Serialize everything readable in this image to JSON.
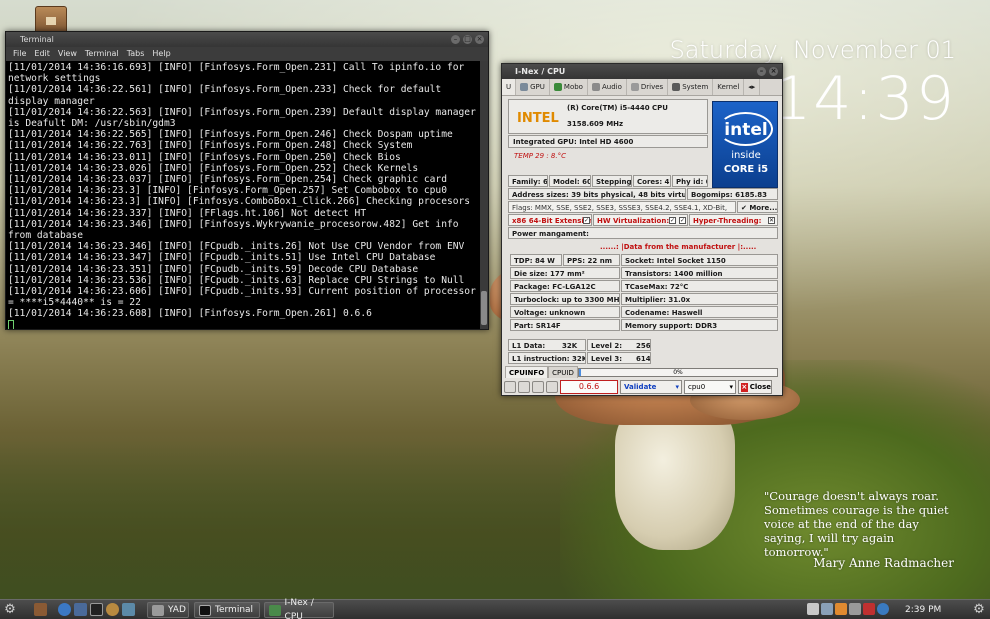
{
  "desktop": {
    "date": "Saturday, November 01",
    "time": "14:39",
    "quote": "\"Courage doesn't always roar. Sometimes courage is the quiet voice at the end of the day saying, I will try again tomorrow.\"",
    "quote_author": "Mary Anne Radmacher"
  },
  "terminal": {
    "title": "Terminal",
    "menu": [
      "File",
      "Edit",
      "View",
      "Terminal",
      "Tabs",
      "Help"
    ],
    "lines": [
      "[11/01/2014 14:36:16.693] [INFO] [Finfosys.Form_Open.231] Call To ipinfo.io for network settings",
      "[11/01/2014 14:36:22.561] [INFO] [Finfosys.Form_Open.233] Check for default display manager",
      "[11/01/2014 14:36:22.563] [INFO] [Finfosys.Form_Open.239] Default display manager is Deafult DM: /usr/sbin/gdm3",
      "[11/01/2014 14:36:22.565] [INFO] [Finfosys.Form_Open.246] Check Dospam uptime",
      "[11/01/2014 14:36:22.763] [INFO] [Finfosys.Form_Open.248] Check System",
      "[11/01/2014 14:36:23.011] [INFO] [Finfosys.Form_Open.250] Check Bios",
      "[11/01/2014 14:36:23.026] [INFO] [Finfosys.Form_Open.252] Check Kernels",
      "[11/01/2014 14:36:23.037] [INFO] [Finfosys.Form_Open.254] Check graphic card",
      "[11/01/2014 14:36:23.3] [INFO] [Finfosys.Form_Open.257] Set Combobox to cpu0",
      "[11/01/2014 14:36:23.3] [INFO] [Finfosys.ComboBox1_Click.266] Checking procesors",
      "[11/01/2014 14:36:23.337] [INFO] [FFlags.ht.106] Not detect HT",
      "[11/01/2014 14:36:23.346] [INFO] [Finfosys.Wykrywanie_procesorow.482] Get info from database",
      "[11/01/2014 14:36:23.346] [INFO] [FCpudb._inits.26] Not Use CPU Vendor from ENV",
      "[11/01/2014 14:36:23.347] [INFO] [FCpudb._inits.51] Use Intel CPU Database",
      "[11/01/2014 14:36:23.351] [INFO] [FCpudb._inits.59] Decode CPU Database",
      "[11/01/2014 14:36:23.536] [INFO] [FCpudb._inits.63] Replace CPU Strings to Null",
      "[11/01/2014 14:36:23.606] [INFO] [FCpudb._inits.93] Current position of processor = ****i5*4440** is = 22",
      "[11/01/2014 14:36:23.608] [INFO] [Finfosys.Form_Open.261] 0.6.6"
    ]
  },
  "inex": {
    "title": "I-Nex / CPU",
    "tabs": [
      "U",
      "GPU",
      "Mobo",
      "Audio",
      "Drives",
      "System",
      "Kernel"
    ],
    "tab_arrows": "◂▸",
    "vendor": "INTEL",
    "cpu_name": "(R) Core(TM) i5-4440 CPU",
    "cpu_mhz": "3158.609 MHz",
    "integrated_gpu": "Integrated GPU: Intel HD 4600",
    "temp": "TEMP 29 : 8.°C",
    "logo_intel": "intel",
    "logo_inside": "inside",
    "logo_core": "CORE i5",
    "family": "Family:  6",
    "model": "Model:  60",
    "stepping": "Stepping:",
    "cores": "Cores:  4",
    "phy_id": "Phy id:  0",
    "address_sizes": "Address sizes:  39 bits physical, 48 bits virtual",
    "bogomips": "Bogomips:  6185.83",
    "flags": "Flags: MMX, SSE, SSE2, SSE3, SSSE3, SSE4.2, SSE4.1, XD-Bit,",
    "more": "More...",
    "x86_64": "x86 64-Bit Extension",
    "hw_virt": "HW Virtualization:",
    "hyper_threading": "Hyper-Threading:",
    "power_mgmt": "Power mangament:",
    "manufacturer_header": "......: |Data from the manufacturer |:.....",
    "specs_left": [
      "TDP: 84 W",
      "Die size: 177 mm²",
      "Package: FC-LGA12C",
      "Turboclock: up to 3300 MHz",
      "Voltage: unknown",
      "Part: SR14F"
    ],
    "pps": "PPS: 22 nm",
    "specs_right": [
      "Socket: Intel Socket 1150",
      "Transistors: 1400 million",
      "TCaseMax: 72°C",
      "Multiplier: 31.0x",
      "Codename: Haswell",
      "Memory support: DDR3"
    ],
    "l1_data_label": "L1 Data:",
    "l1_data_value": "32K",
    "l1_inst_label": "L1 instruction: 32K",
    "l2_label": "Level 2:",
    "l2_value": "256",
    "l3_label": "Level 3:",
    "l3_value": "614",
    "bottom_tabs": [
      "CPUINFO",
      "CPUID"
    ],
    "progress_text": "0%",
    "progress_value": 0.01,
    "version": "0.6.6",
    "validate": "Validate",
    "cpu_select": "cpu0",
    "close": "Close"
  },
  "taskbar": {
    "tasks": [
      "YAD",
      "Terminal",
      "I-Nex / CPU"
    ],
    "clock": "2:39 PM"
  }
}
